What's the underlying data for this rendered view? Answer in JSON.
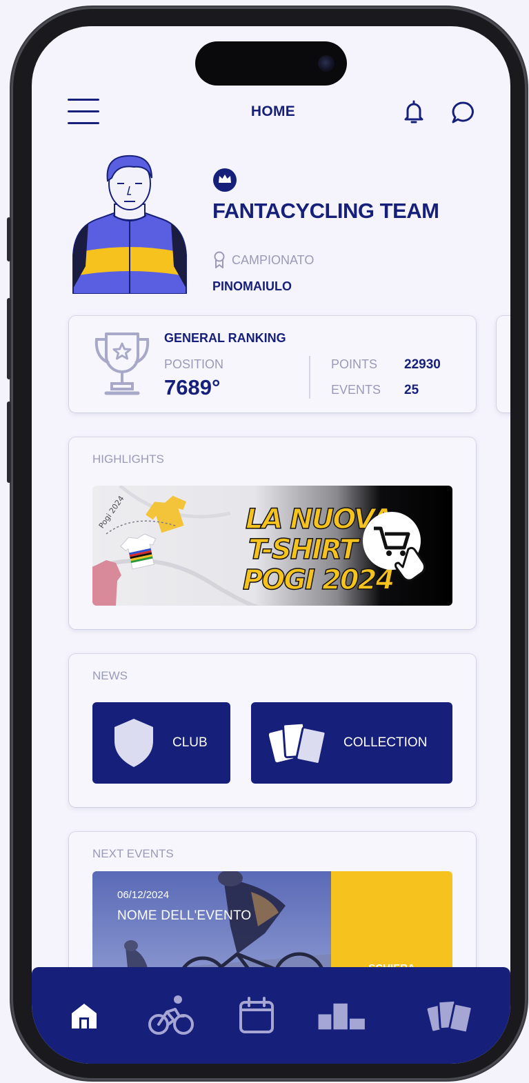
{
  "header": {
    "title": "HOME",
    "menu_icon": "hamburger-menu-icon",
    "notification_icon": "bell-icon",
    "chat_icon": "chat-bubble-icon"
  },
  "profile": {
    "badge_icon": "crown-icon",
    "team_name": "FANTACYCLING TEAM",
    "championship_label": "CAMPIONATO",
    "championship_icon": "award-ribbon-icon",
    "championship_name": "PINOMAIULO"
  },
  "ranking": {
    "title": "GENERAL RANKING",
    "position_label": "POSITION",
    "position": "7689°",
    "points_label": "POINTS",
    "points": "22930",
    "events_label": "EVENTS",
    "events": "25"
  },
  "highlights": {
    "label": "HIGHLIGHTS",
    "banner_lines": [
      "LA NUOVA",
      "T-SHIRT",
      "POGI 2024"
    ],
    "banner_print_text": "Pogi 2024"
  },
  "news": {
    "label": "NEWS",
    "club_label": "CLUB",
    "collection_label": "COLLECTION"
  },
  "next_events": {
    "label": "NEXT EVENTS",
    "date": "06/12/2024",
    "name": "NOME DELL'EVENTO",
    "cta": "SCHIERA"
  },
  "bottom_nav": {
    "items": [
      "home-icon",
      "cyclist-icon",
      "calendar-icon",
      "podium-icon",
      "cards-icon"
    ],
    "active": "home-icon"
  },
  "colors": {
    "navy": "#16207a",
    "muted": "#9a9ab8",
    "background": "#f5f4fc",
    "accent_yellow": "#f6c21e",
    "jersey_blue": "#5a5ee0"
  }
}
